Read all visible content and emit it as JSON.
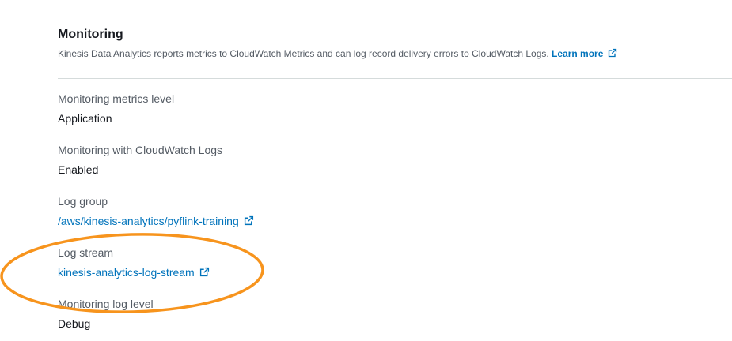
{
  "monitoring": {
    "title": "Monitoring",
    "description": "Kinesis Data Analytics reports metrics to CloudWatch Metrics and can log record delivery errors to CloudWatch Logs.",
    "learn_more": "Learn more",
    "fields": [
      {
        "label": "Monitoring metrics level",
        "value": "Application"
      },
      {
        "label": "Monitoring with CloudWatch Logs",
        "value": "Enabled"
      },
      {
        "label": "Log group",
        "link": "/aws/kinesis-analytics/pyflink-training"
      },
      {
        "label": "Log stream",
        "link": "kinesis-analytics-log-stream"
      },
      {
        "label": "Monitoring log level",
        "value": "Debug"
      }
    ]
  },
  "colors": {
    "link": "#0073bb",
    "label": "#545b64",
    "value": "#16191f",
    "divider": "#d5dbdb",
    "highlight": "#f7941d"
  },
  "icons": {
    "external_link": "external-link-icon"
  }
}
